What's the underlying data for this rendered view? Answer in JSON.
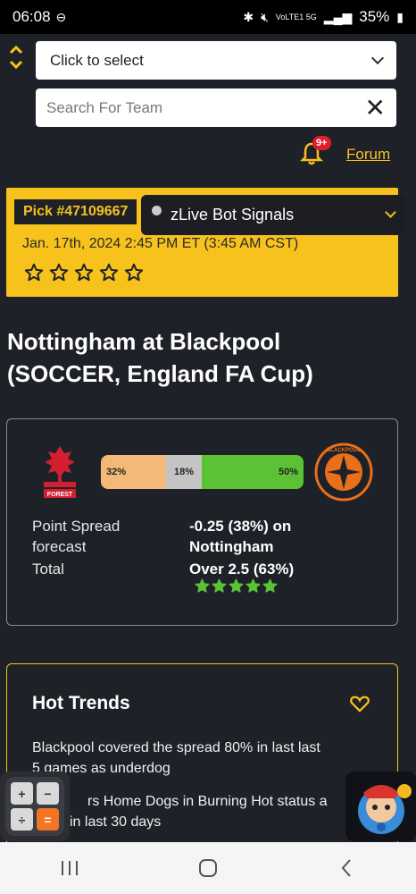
{
  "status_bar": {
    "time": "06:08",
    "signal_text": "VoLTE1 5G",
    "battery": "35%"
  },
  "controls": {
    "select_label": "Click to select",
    "search_placeholder": "Search For Team",
    "notification_count": "9+",
    "forum_label": "Forum"
  },
  "pick": {
    "id": "Pick #47109667",
    "date": "Jan. 17th, 2024 2:45 PM ET (3:45 AM CST)",
    "stars_filled": 0,
    "stars_total": 5
  },
  "bot_signals": {
    "label": "zLive Bot Signals"
  },
  "match": {
    "title": "Nottingham at Blackpool (SOCCER, England FA Cup)"
  },
  "forecast": {
    "home_pct": "32%",
    "draw_pct": "18%",
    "away_pct": "50%",
    "home_share": 32,
    "draw_share": 18,
    "away_share": 50,
    "spread_label_1": "Point Spread",
    "spread_label_2": "forecast",
    "spread_value_1": "-0.25 (38%) on",
    "spread_value_2": "Nottingham",
    "total_label": "Total",
    "total_value": "Over 2.5 (63%)",
    "stars_filled": 5,
    "left_logo_text": "FOREST",
    "right_logo_text": "BLACKPOOL"
  },
  "hot_trends": {
    "title": "Hot Trends",
    "items": [
      "Blackpool covered the spread 80% in last last 5 games as underdog",
      "...ers Home Dogs in Burning Hot status a... in last 30 days"
    ],
    "item1_line1": "Blackpool covered the spread 80% in last last",
    "item1_line2": "5 games as underdog",
    "item2_line1": "rs Home Dogs in Burning Hot status a",
    "item2_line2": "in last 30 days"
  },
  "colors": {
    "accent": "#f6c21b",
    "background": "#1f2128",
    "home_bar": "#f2b979",
    "draw_bar": "#c4c4c4",
    "away_bar": "#5bc236"
  }
}
